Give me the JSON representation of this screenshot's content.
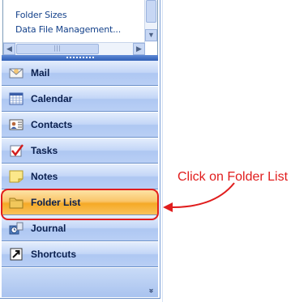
{
  "folder_tree": {
    "items": [
      "Folder Sizes",
      "Data File Management..."
    ]
  },
  "navigation": {
    "buttons": [
      {
        "label": "Mail",
        "icon": "mail-icon"
      },
      {
        "label": "Calendar",
        "icon": "calendar-icon"
      },
      {
        "label": "Contacts",
        "icon": "contacts-icon"
      },
      {
        "label": "Tasks",
        "icon": "tasks-icon"
      },
      {
        "label": "Notes",
        "icon": "notes-icon"
      },
      {
        "label": "Folder List",
        "icon": "folder-icon",
        "active": true
      },
      {
        "label": "Journal",
        "icon": "journal-icon"
      },
      {
        "label": "Shortcuts",
        "icon": "shortcut-icon"
      }
    ],
    "footer_chevron": "»"
  },
  "annotation": {
    "callout_text": "Click on Folder List",
    "color": "#e01d1d"
  },
  "colors": {
    "nav_blue": "#c3d6f7",
    "active_orange": "#f5a926",
    "splitter_blue": "#2e5fb6"
  }
}
